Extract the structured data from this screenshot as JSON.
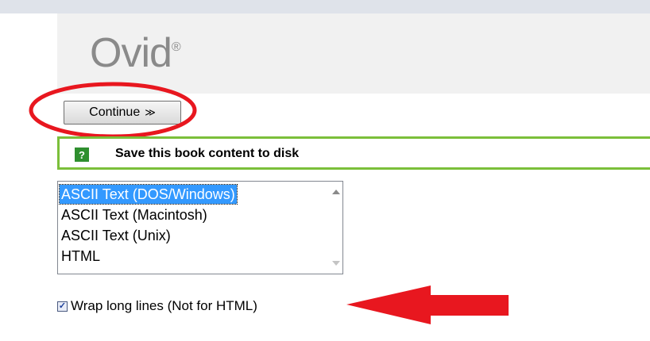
{
  "header": {
    "logo_text": "Ovid",
    "logo_mark": "®"
  },
  "toolbar": {
    "continue_label": "Continue",
    "continue_chevron": "≫"
  },
  "save_panel": {
    "help_icon": "?",
    "title": "Save this book content to disk"
  },
  "format_list": {
    "options": [
      "ASCII Text (DOS/Windows)",
      "ASCII Text (Macintosh)",
      "ASCII Text (Unix)",
      "HTML"
    ],
    "selected": "ASCII Text (DOS/Windows)"
  },
  "wrap_option": {
    "label": "Wrap long lines (Not for HTML)",
    "checked": true
  },
  "colors": {
    "annotation_red": "#e8171f",
    "panel_border_green": "#7bbf3a",
    "selection_blue": "#3399ff",
    "help_icon_green": "#2f8f2f"
  },
  "icons": {
    "help": "help-icon",
    "scroll_up": "scroll-up-icon",
    "scroll_down": "scroll-down-icon",
    "checkbox": "checkbox-icon"
  }
}
